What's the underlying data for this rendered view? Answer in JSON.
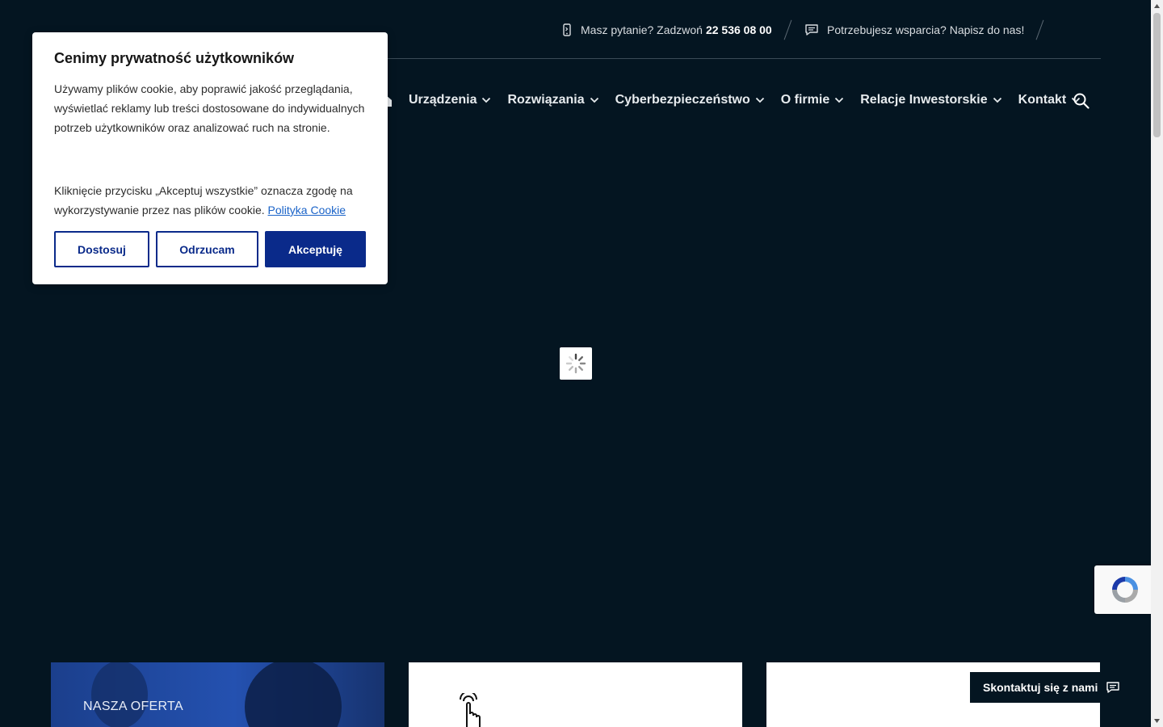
{
  "topbar": {
    "phone_prefix": "Masz pytanie? Zadzwoń",
    "phone_number": "22 536 08 00",
    "support_text": "Potrzebujesz wsparcia? Napisz do nas!",
    "phone_icon": "phone-icon",
    "chat_icon": "chat-icon"
  },
  "nav": {
    "home_icon": "home-icon",
    "items": [
      {
        "label": "Urządzenia"
      },
      {
        "label": "Rozwiązania"
      },
      {
        "label": "Cyberbezpieczeństwo"
      },
      {
        "label": "O firmie"
      },
      {
        "label": "Relacje Inwestorskie"
      },
      {
        "label": "Kontakt"
      }
    ],
    "search_icon": "search-icon"
  },
  "cookie": {
    "title": "Cenimy prywatność użytkowników",
    "text1": "Używamy plików cookie, aby poprawić jakość przeglądania, wyświetlać reklamy lub treści dostosowane do indywidualnych potrzeb użytkowników oraz analizować ruch na stronie.",
    "text2": "Kliknięcie przycisku „Akceptuj wszystkie” oznacza zgodę na wykorzystywanie przez nas plików cookie.",
    "link": "Polityka Cookie",
    "btn_customize": "Dostosuj",
    "btn_reject": "Odrzucam",
    "btn_accept": "Akceptuję"
  },
  "cards": {
    "offer_label": "NASZA OFERTA",
    "touch_icon": "touch-icon"
  },
  "contact": {
    "label": "Skontaktuj się z nami",
    "icon": "chat-icon"
  },
  "colors": {
    "background": "#041521",
    "accent": "#0a2a8a",
    "link": "#1a63c8"
  }
}
